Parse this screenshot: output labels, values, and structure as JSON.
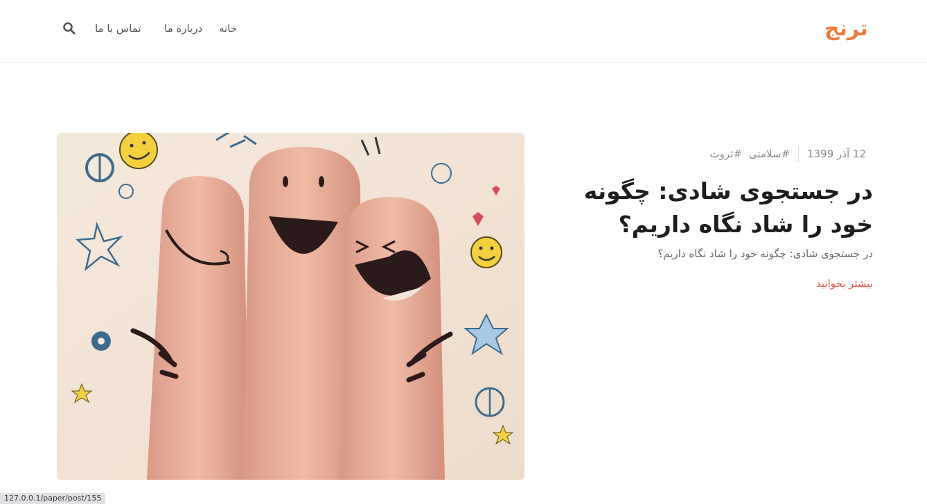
{
  "header": {
    "logo": "ترنج",
    "nav": {
      "home": "خانه",
      "about": "درباره ما",
      "contact": "تماس با ما"
    },
    "search_icon": "search-icon"
  },
  "post": {
    "date": "12 آذر 1399",
    "tags": [
      "#ثروت",
      "#سلامتی"
    ],
    "title": "در جستجوی شادی: چگونه خود را شاد نگاه داریم؟",
    "excerpt": "در جستجوی شادی: چگونه خود را شاد نگاه داریم؟",
    "read_more": "بیشتر بخوانید",
    "image": "smiling-fingers-image"
  },
  "status_bar": {
    "url": "127.0.0.1/paper/post/155"
  },
  "colors": {
    "accent": "#f07a3a",
    "link": "#e8533b",
    "meta": "#8a8a8a"
  }
}
